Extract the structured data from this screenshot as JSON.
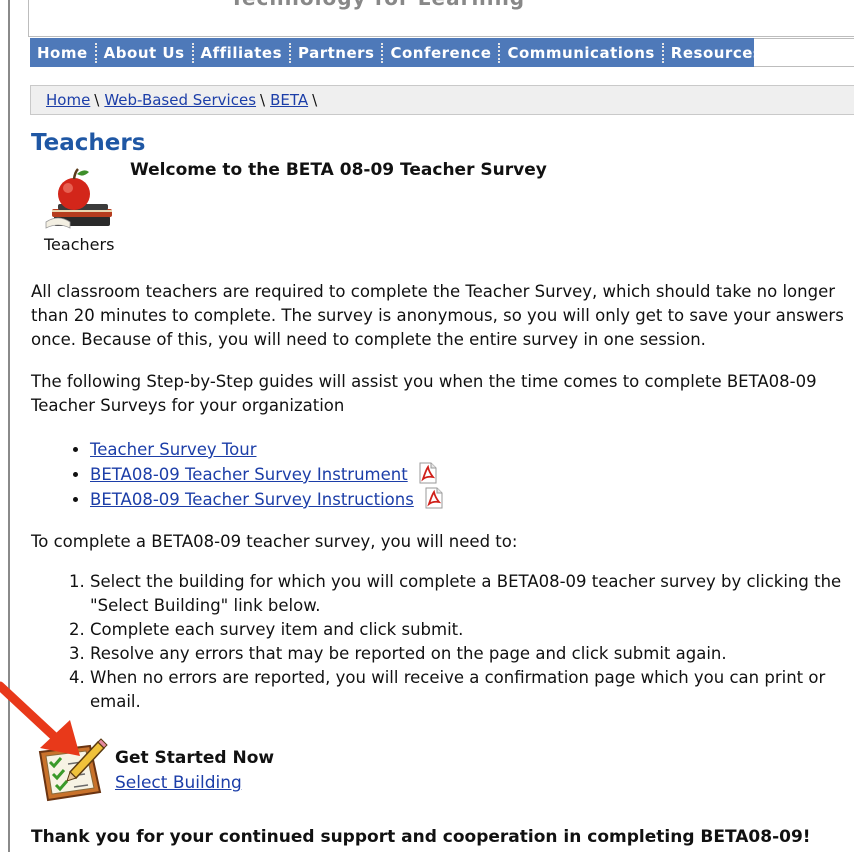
{
  "header": {
    "tagline": "Technology for Learning"
  },
  "nav": {
    "items": [
      "Home",
      "About Us",
      "Affiliates",
      "Partners",
      "Conference",
      "Communications",
      "Resources"
    ]
  },
  "breadcrumb": {
    "items": [
      "Home",
      "Web-Based Services",
      "BETA"
    ],
    "separator": "\\"
  },
  "content": {
    "title": "Teachers",
    "welcome": "Welcome to the BETA 08-09 Teacher Survey",
    "icon_caption": "Teachers",
    "para1": [
      "All classroom teachers are required to complete the Teacher Survey, which should take no longer",
      "than 20 minutes to complete. The survey is anonymous, so you will only get to save your answers",
      "once. Because of this, you will need to complete the entire survey in one session."
    ],
    "para2": [
      "The following Step-by-Step guides will assist you when the time comes to complete BETA08-09",
      "Teacher Surveys for your organization"
    ],
    "guides": [
      {
        "label": "Teacher Survey Tour",
        "pdf": false
      },
      {
        "label": "BETA08-09 Teacher Survey Instrument",
        "pdf": true
      },
      {
        "label": "BETA08-09 Teacher Survey Instructions",
        "pdf": true
      }
    ],
    "steps_intro": "To complete a BETA08-09 teacher survey, you will need to:",
    "steps": [
      [
        "Select the building for which you will complete a BETA08-09 teacher survey by clicking the",
        "\"Select Building\" link below."
      ],
      [
        "Complete each survey item and click submit."
      ],
      [
        "Resolve any errors that may be reported on the page and click submit again."
      ],
      [
        "When no errors are reported, you will receive a confirmation page which you can print or",
        "email."
      ]
    ],
    "get_started": "Get Started Now",
    "select_building": "Select Building",
    "thanks": "Thank you for your continued support and cooperation in completing BETA08-09!"
  },
  "icons": {
    "teacher": "apple-books-icon",
    "pdf": "pdf-icon",
    "clipboard": "clipboard-pencil-icon",
    "arrow": "red-arrow-annotation"
  },
  "colors": {
    "nav_bg": "#4e79b9",
    "title": "#1f57a4",
    "link": "#1c3ea8",
    "arrow": "#e8391a"
  }
}
